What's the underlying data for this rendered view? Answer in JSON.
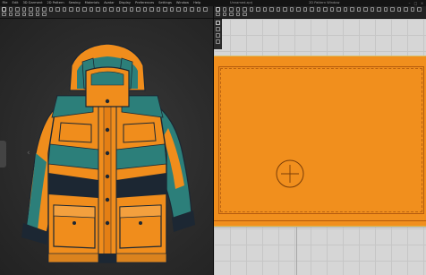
{
  "menu": {
    "items": [
      "File",
      "Edit",
      "3D Garment",
      "2D Pattern",
      "Sewing",
      "Materials",
      "Avatar",
      "Display",
      "Preferences",
      "Settings",
      "Window",
      "Help"
    ],
    "file_name": "Unnamed.zprj",
    "panel_title": "2D Pattern Window"
  },
  "viewport_3d": {
    "garment": "jacket",
    "colors": {
      "orange": "#f08d1c",
      "teal": "#2c7f7a",
      "navy": "#1c2733",
      "background": "#2c2c2c"
    }
  },
  "viewport_2d": {
    "grid_color": "#d6d6d6",
    "panel_color": "#f18f1d",
    "marker": "crosshair-target-icon"
  }
}
